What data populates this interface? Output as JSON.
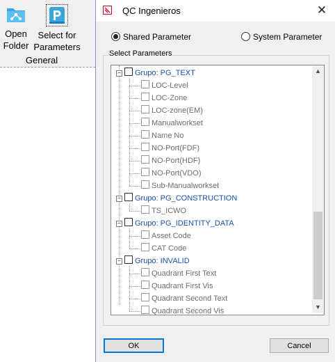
{
  "ribbon": {
    "open_folder": {
      "line1": "Open",
      "line2": "Folder",
      "icon": "folder-network-icon"
    },
    "select_params": {
      "line1": "Select for",
      "line2": "Parameters",
      "icon": "parameter-p-icon"
    },
    "group_label": "General"
  },
  "dialog": {
    "title": "QC Ingenieros",
    "close_glyph": "✕",
    "shared_label": "Shared Parameter",
    "system_label": "System Parameter",
    "selected_mode": "shared",
    "groupbox_label": "Select Parameters",
    "ok_label": "OK",
    "cancel_label": "Cancel"
  },
  "tree": {
    "groups": [
      {
        "label": "Grupo: PG_TEXT",
        "items": [
          "LOC-Level",
          "LOC-Zone",
          "LOC-zone(EM)",
          "Manualworkset",
          "Name No",
          "NO-Port(FDF)",
          "NO-Port(HDF)",
          "NO-Port(VDO)",
          "Sub-Manualworkset"
        ]
      },
      {
        "label": "Grupo: PG_CONSTRUCTION",
        "items": [
          "TS_ICWO"
        ]
      },
      {
        "label": "Grupo: PG_IDENTITY_DATA",
        "items": [
          "Asset Code",
          "CAT Code"
        ]
      },
      {
        "label": "Grupo: INVALID",
        "items": [
          "Quadrant First Text",
          "Quadrant First Vis",
          "Quadrant Second Text",
          "Quadrant Second Vis"
        ]
      }
    ],
    "collapse_glyph": "−"
  },
  "colors": {
    "accent": "#0078d7",
    "group_text": "#1a4fb0",
    "leaf_text": "#6d6d6d",
    "app_icon": "#c8102e"
  }
}
